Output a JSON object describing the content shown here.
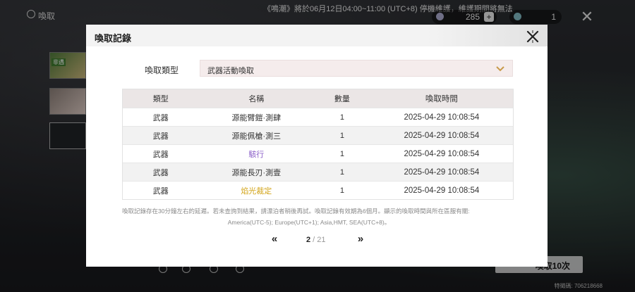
{
  "background": {
    "page_title": "喚取",
    "marquee": "《鳴潮》將於06月12日04:00~11:00 (UTC+8) 停機維護，維護期間將無法",
    "currency_1": "285",
    "currency_2": "1",
    "thumb_label": "非遇",
    "pull_button": "喚取10次",
    "uid": "特徵碼: 706218668"
  },
  "modal": {
    "title": "喚取記錄",
    "filter_label": "喚取類型",
    "filter_value": "武器活動喚取",
    "table": {
      "headers": [
        "類型",
        "名稱",
        "數量",
        "喚取時間"
      ],
      "rows": [
        {
          "type": "武器",
          "name": "源能臂鎧·測肆",
          "qty": "1",
          "time": "2025-04-29 10:08:54",
          "rarity": "normal"
        },
        {
          "type": "武器",
          "name": "源能佩槍·測三",
          "qty": "1",
          "time": "2025-04-29 10:08:54",
          "rarity": "normal"
        },
        {
          "type": "武器",
          "name": "駭行",
          "qty": "1",
          "time": "2025-04-29 10:08:54",
          "rarity": "purple"
        },
        {
          "type": "武器",
          "name": "源能長刃·測壹",
          "qty": "1",
          "time": "2025-04-29 10:08:54",
          "rarity": "normal"
        },
        {
          "type": "武器",
          "name": "焰光裁定",
          "qty": "1",
          "time": "2025-04-29 10:08:54",
          "rarity": "gold"
        }
      ]
    },
    "note_line1": "喚取記錄存在30分鐘左右的延遲。若未查詢到結果，請漂泊者稍後再試。喚取記錄有效期為6個月。顯示的喚取時間與所在區服有關:",
    "note_line2": "America(UTC-5); Europe(UTC+1); Asia,HMT, SEA(UTC+8)。",
    "pager": {
      "prev": "«",
      "next": "»",
      "current": "2",
      "separator": " / ",
      "total": "21"
    }
  },
  "colors": {
    "purple": "#8a5ec7",
    "gold": "#d3a51b",
    "header_bg": "#ebe6e6",
    "select_bg": "#f5ecec"
  }
}
